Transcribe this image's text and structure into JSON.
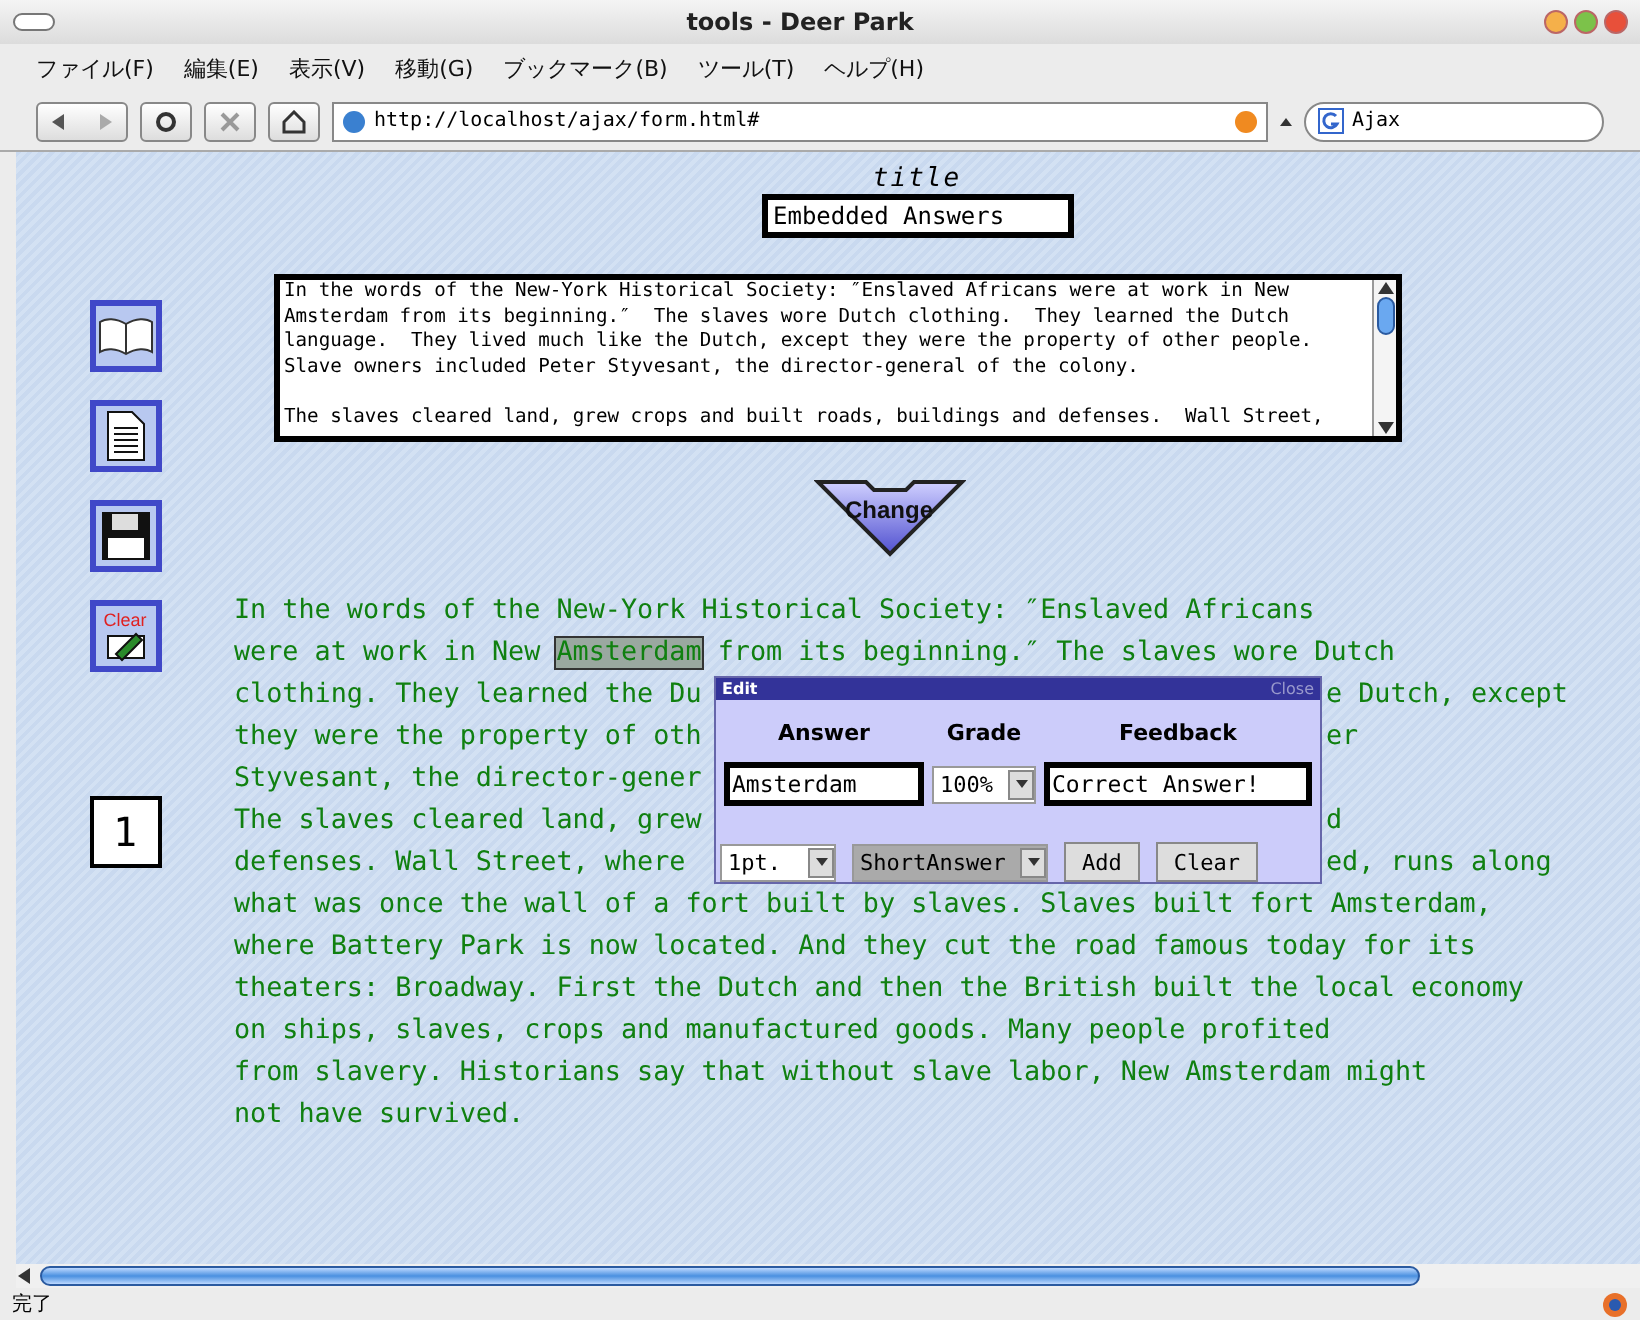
{
  "window": {
    "title": "tools - Deer Park"
  },
  "menu": [
    "ファイル(F)",
    "編集(E)",
    "表示(V)",
    "移動(G)",
    "ブックマーク(B)",
    "ツール(T)",
    "ヘルプ(H)"
  ],
  "address": {
    "value": "http://localhost/ajax/form.html#"
  },
  "search": {
    "value": "Ajax"
  },
  "sidebar": {
    "tools": [
      {
        "kind": "book"
      },
      {
        "kind": "document"
      },
      {
        "kind": "save"
      },
      {
        "kind": "clear",
        "label": "Clear"
      }
    ],
    "page_number": "1"
  },
  "title_field": {
    "label": "title",
    "value": "Embedded Answers"
  },
  "source_text": {
    "paragraphs": [
      [
        "In the words of the New-York Historical Society: ″Enslaved Africans were at work in New",
        "Amsterdam from its beginning.″  The slaves wore Dutch clothing.  They learned the Dutch",
        "language.  They lived much like the Dutch, except they were the property of other people.",
        "Slave owners included Peter Styvesant, the director-general of the colony."
      ],
      [
        "The slaves cleared land, grew crops and built roads, buildings and defenses.  Wall Street,"
      ]
    ]
  },
  "change_button": {
    "label": "Change"
  },
  "passage": [
    {
      "kind": "full",
      "segments": [
        {
          "text": "In the words of the New-York Historical Society: ″Enslaved Africans",
          "highlighted": false
        }
      ]
    },
    {
      "kind": "full",
      "segments": [
        {
          "text": "were at work in New ",
          "highlighted": false
        },
        {
          "text": "Amsterdam",
          "highlighted": true
        },
        {
          "text": " from its beginning.″ The slaves wore Dutch",
          "highlighted": false
        }
      ]
    },
    {
      "kind": "split",
      "left": "clothing. They learned the Du",
      "right": "e Dutch, except"
    },
    {
      "kind": "split",
      "left": "they were the property of oth",
      "right": "er"
    },
    {
      "kind": "split",
      "left": "Styvesant, the director-gener"
    },
    {
      "kind": "split",
      "left": "The slaves cleared land, grew",
      "right": "d"
    },
    {
      "kind": "split",
      "left": "defenses. Wall Street, where",
      "right": "ed, runs along"
    },
    {
      "kind": "full",
      "segments": [
        {
          "text": "what was once the wall of a fort built by slaves. Slaves built fort Amsterdam,",
          "highlighted": false
        }
      ]
    },
    {
      "kind": "full",
      "segments": [
        {
          "text": "where Battery Park is now located. And they cut the road famous today for its",
          "highlighted": false
        }
      ]
    },
    {
      "kind": "full",
      "segments": [
        {
          "text": "theaters: Broadway. First the Dutch and then the British built the local economy",
          "highlighted": false
        }
      ]
    },
    {
      "kind": "full",
      "segments": [
        {
          "text": "on ships, slaves, crops and manufactured goods. Many people profited",
          "highlighted": false
        }
      ]
    },
    {
      "kind": "full",
      "segments": [
        {
          "text": "from slavery. Historians say that without slave labor, New Amsterdam might",
          "highlighted": false
        }
      ]
    },
    {
      "kind": "full",
      "segments": [
        {
          "text": "not have survived.",
          "highlighted": false
        }
      ]
    }
  ],
  "edit_popup": {
    "title": "Edit",
    "close": "Close",
    "headers": [
      "Answer",
      "Grade",
      "Feedback"
    ],
    "answer": "Amsterdam",
    "grade": "100%",
    "feedback": "Correct Answer!",
    "points": "1pt.",
    "type": "ShortAnswer",
    "buttons": [
      "Add",
      "Clear"
    ]
  },
  "status_bar": {
    "text": "完了"
  }
}
